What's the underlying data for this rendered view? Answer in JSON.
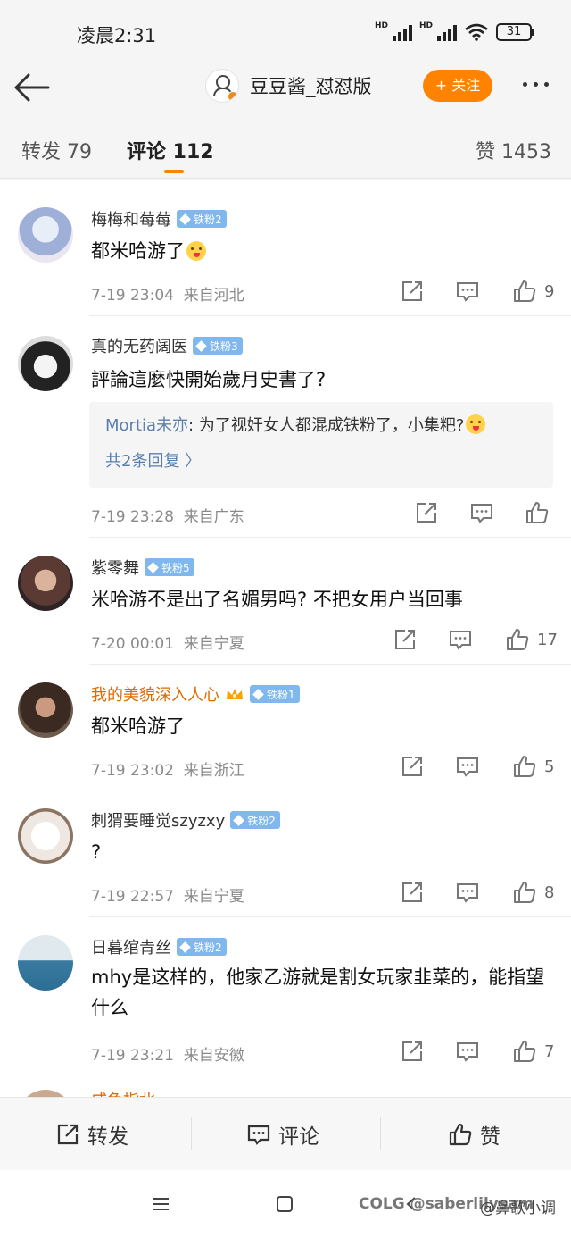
{
  "status_bar": {
    "time": "凌晨2:31",
    "battery": "31",
    "network_label": "HD"
  },
  "header": {
    "title": "豆豆酱_怼怼版",
    "follow_label": "+ 关注"
  },
  "tabs": {
    "repost": "转发 79",
    "comment": "评论 112",
    "like": "赞 1453"
  },
  "comments": [
    {
      "user": "梅梅和莓莓",
      "badge": "铁粉2",
      "text": "都米哈游了",
      "emoji": "tongue-emoji",
      "time": "7-19 23:04",
      "location": "来自河北",
      "likes": "9"
    },
    {
      "user": "真的无药阔医",
      "badge": "铁粉3",
      "text": "評論這麼快開始歲月史書了?",
      "time": "7-19 23:28",
      "location": "来自广东",
      "likes": "",
      "reply": {
        "user": "Mortia未亦",
        "text": ": 为了视奸女人都混成铁粉了，小集粑?",
        "more": "共2条回复 〉"
      }
    },
    {
      "user": "紫零舞",
      "badge": "铁粉5",
      "text": "米哈游不是出了名媚男吗? 不把女用户当回事",
      "time": "7-20 00:01",
      "location": "来自宁夏",
      "likes": "17"
    },
    {
      "user": "我的美貌深入人心",
      "badge": "铁粉1",
      "text": "都米哈游了",
      "time": "7-19 23:02",
      "location": "来自浙江",
      "likes": "5"
    },
    {
      "user": "刺猬要睡觉szyzxy",
      "badge": "铁粉2",
      "text": "?",
      "time": "7-19 22:57",
      "location": "来自宁夏",
      "likes": "8"
    },
    {
      "user": "日暮绾青丝",
      "badge": "铁粉2",
      "text": "mhy是这样的，他家乙游就是割女玩家韭菜的，能指望什么",
      "time": "7-19 23:21",
      "location": "来自安徽",
      "likes": "7"
    }
  ],
  "partial": {
    "user": "咸鱼指北"
  },
  "bottom_bar": {
    "repost": "转发",
    "comment": "评论",
    "like": "赞"
  },
  "watermark": {
    "left": "COLG @saberlilysam",
    "right": "@鼻歌小调"
  },
  "colors": {
    "accent": "#ff8200",
    "fan_badge": "#7fb7ee",
    "link": "#5b7fad"
  }
}
